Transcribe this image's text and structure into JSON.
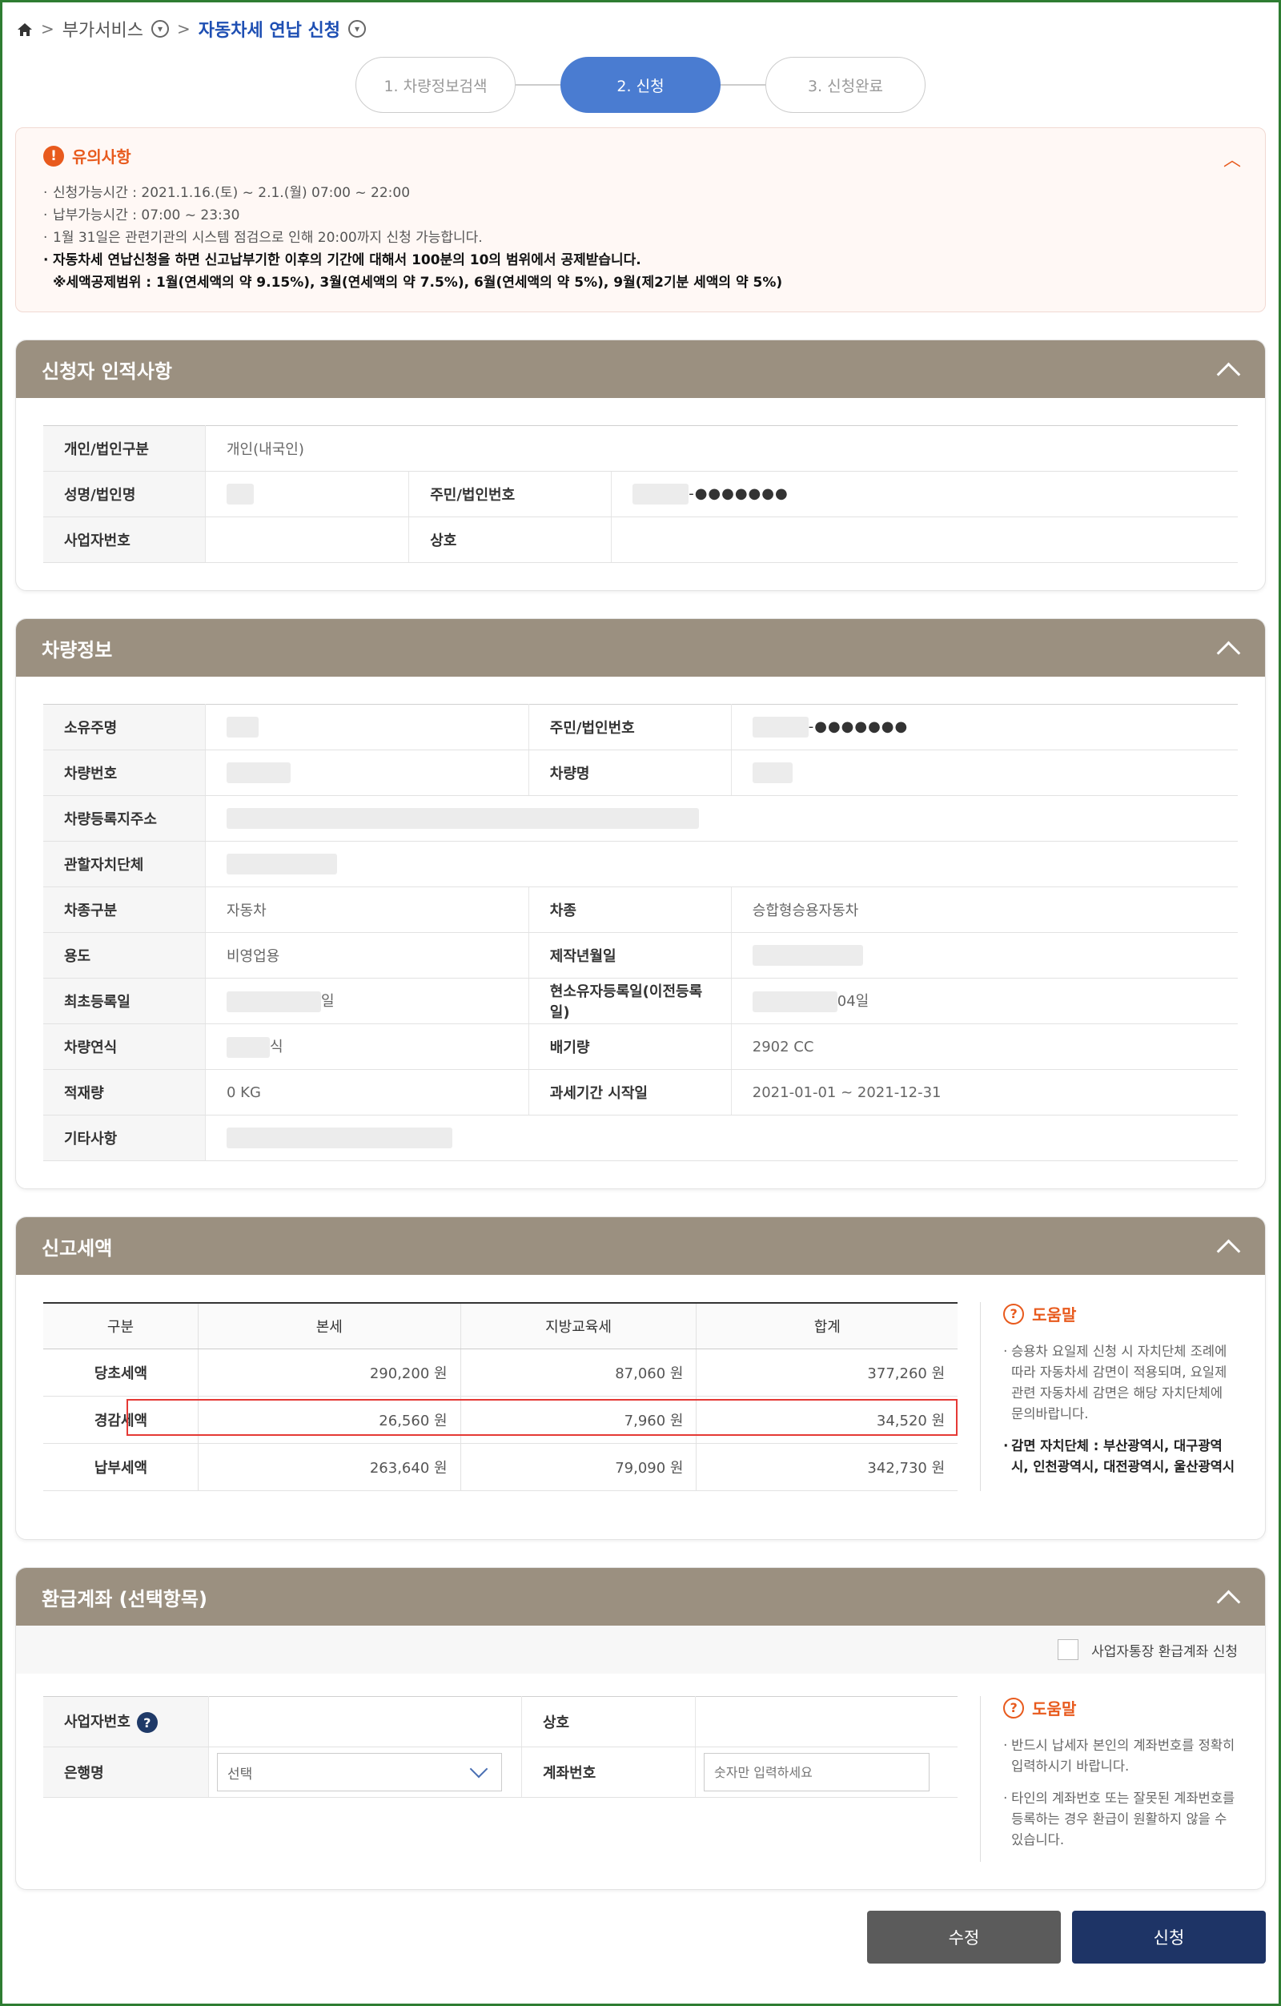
{
  "breadcrumb": {
    "level1": "부가서비스",
    "level2": "자동차세 연납 신청"
  },
  "steps": [
    "1. 차량정보검색",
    "2. 신청",
    "3. 신청완료"
  ],
  "notice": {
    "title": "유의사항",
    "items": [
      "신청가능시간 : 2021.1.16.(토) ~ 2.1.(월) 07:00 ~ 22:00",
      "납부가능시간 : 07:00 ~ 23:30",
      "1월 31일은 관련기관의 시스템 점검으로 인해 20:00까지 신청 가능합니다.",
      "자동차세 연납신청을 하면 신고납부기한 이후의 기간에 대해서 100분의 10의 범위에서 공제받습니다.",
      "※세액공제범위 : 1월(연세액의 약 9.15%), 3월(연세액의 약 7.5%), 6월(연세액의 약 5%), 9월(제2기분 세액의 약 5%)"
    ]
  },
  "applicant": {
    "title": "신청자 인적사항",
    "type_label": "개인/법인구분",
    "type_value": "개인(내국인)",
    "name_label": "성명/법인명",
    "id_label": "주민/법인번호",
    "id_mask": "-●●●●●●●",
    "biz_label": "사업자번호",
    "company_label": "상호"
  },
  "vehicle": {
    "title": "차량정보",
    "owner_label": "소유주명",
    "id_label": "주민/법인번호",
    "id_mask": "-●●●●●●●",
    "number_label": "차량번호",
    "name_label": "차량명",
    "address_label": "차량등록지주소",
    "authority_label": "관할자치단체",
    "class_label": "차종구분",
    "class_value": "자동차",
    "kind_label": "차종",
    "kind_value": "승합형승용자동차",
    "use_label": "용도",
    "use_value": "비영업용",
    "made_label": "제작년월일",
    "first_reg_label": "최초등록일",
    "first_reg_suffix": "일",
    "owner_reg_label": "현소유자등록일(이전등록일)",
    "owner_reg_suffix": "04일",
    "model_year_label": "차량연식",
    "model_year_suffix": "식",
    "displacement_label": "배기량",
    "displacement_value": "2902 CC",
    "load_label": "적재량",
    "load_value": "0 KG",
    "period_label": "과세기간 시작일",
    "period_value": "2021-01-01 ~ 2021-12-31",
    "etc_label": "기타사항"
  },
  "tax": {
    "title": "신고세액",
    "headers": [
      "구분",
      "본세",
      "지방교육세",
      "합계"
    ],
    "rows": [
      [
        "당초세액",
        "290,200 원",
        "87,060 원",
        "377,260 원"
      ],
      [
        "경감세액",
        "26,560 원",
        "7,960 원",
        "34,520 원"
      ],
      [
        "납부세액",
        "263,640 원",
        "79,090 원",
        "342,730 원"
      ]
    ],
    "help_title": "도움말",
    "help_text": "승용차 요일제 신청 시 자치단체 조례에 따라 자동차세 감면이 적용되며, 요일제 관련 자동차세 감면은 해당 자치단체에 문의바랍니다.",
    "help_bold": "감면 자치단체 : 부산광역시, 대구광역시, 인천광역시, 대전광역시, 울산광역시"
  },
  "refund": {
    "title": "환급계좌 (선택항목)",
    "checkbox_label": "사업자통장 환급계좌 신청",
    "biz_label": "사업자번호",
    "company_label": "상호",
    "bank_label": "은행명",
    "bank_selected": "선택",
    "account_label": "계좌번호",
    "account_placeholder": "숫자만 입력하세요",
    "help_title": "도움말",
    "help_1": "반드시 납세자 본인의 계좌번호를 정확히 입력하시기 바랍니다.",
    "help_2": "타인의 계좌번호 또는 잘못된 계좌번호를 등록하는 경우 환급이 원활하지 않을 수 있습니다."
  },
  "buttons": {
    "edit": "수정",
    "apply": "신청"
  },
  "colors": {
    "accent": "#4a7cd1",
    "panel_header": "#9b9080",
    "notice": "#e85a1d",
    "navy": "#1e3466"
  }
}
